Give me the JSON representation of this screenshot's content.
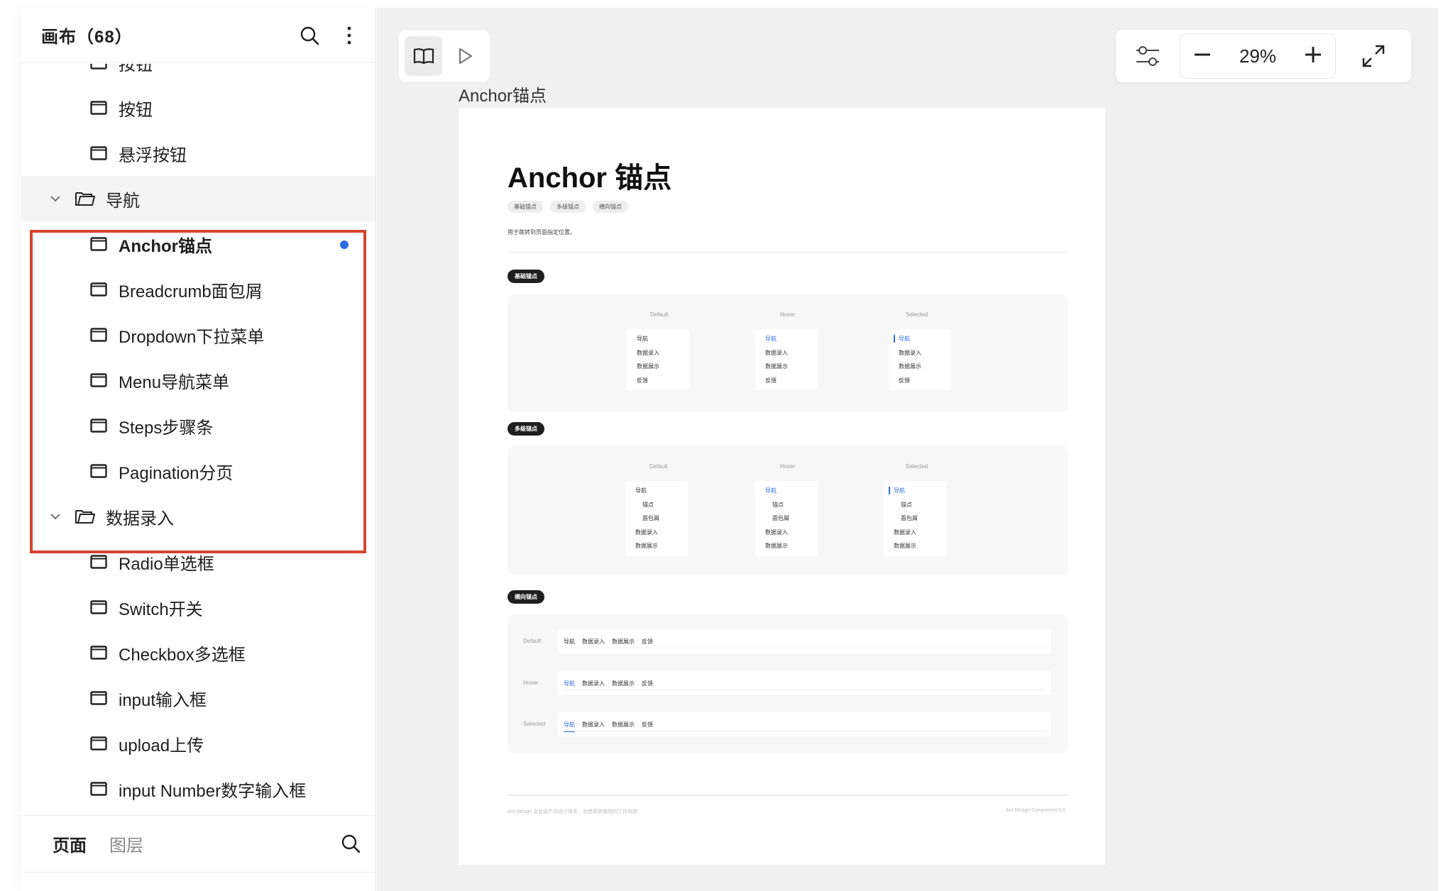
{
  "sidebar": {
    "title": "画布（68）",
    "partial_item": "按钮",
    "items": [
      {
        "type": "page",
        "label": "按钮"
      },
      {
        "type": "page",
        "label": "悬浮按钮"
      },
      {
        "type": "folder",
        "label": "导航"
      },
      {
        "type": "page",
        "label": "Anchor锚点"
      },
      {
        "type": "page",
        "label": "Breadcrumb面包屑"
      },
      {
        "type": "page",
        "label": "Dropdown下拉菜单"
      },
      {
        "type": "page",
        "label": "Menu导航菜单"
      },
      {
        "type": "page",
        "label": "Steps步骤条"
      },
      {
        "type": "page",
        "label": "Pagination分页"
      },
      {
        "type": "folder",
        "label": "数据录入"
      },
      {
        "type": "page",
        "label": "Radio单选框"
      },
      {
        "type": "page",
        "label": "Switch开关"
      },
      {
        "type": "page",
        "label": "Checkbox多选框"
      },
      {
        "type": "page",
        "label": "input输入框"
      },
      {
        "type": "page",
        "label": "upload上传"
      },
      {
        "type": "page",
        "label": "input Number数字输入框"
      }
    ],
    "footer": {
      "pages_tab": "页面",
      "layers_tab": "图层"
    }
  },
  "canvas": {
    "frame_label": "Anchor锚点",
    "zoom": "29%",
    "icons": {
      "read_mode": "book-icon",
      "play": "play-icon",
      "settings": "sliders-icon",
      "zoom_out": "minus-icon",
      "zoom_in": "plus-icon",
      "fullscreen": "expand-icon"
    }
  },
  "artboard": {
    "title": "Anchor 锚点",
    "tags": [
      "基础锚点",
      "多级锚点",
      "横向锚点"
    ],
    "description": "用于跳转到页面指定位置。",
    "section1": {
      "pill": "基础锚点",
      "columns": [
        {
          "head": "Default",
          "items": [
            "导航",
            "数据录入",
            "数据展示",
            "反馈"
          ]
        },
        {
          "head": "Hover",
          "items": [
            "导航",
            "数据录入",
            "数据展示",
            "反馈"
          ]
        },
        {
          "head": "Selected",
          "items": [
            "导航",
            "数据录入",
            "数据展示",
            "反馈"
          ]
        }
      ]
    },
    "section2": {
      "pill": "多级锚点",
      "columns": [
        {
          "head": "Default",
          "items": [
            "导航",
            "锚点",
            "面包屑",
            "数据录入",
            "数据展示"
          ]
        },
        {
          "head": "Hover",
          "items": [
            "导航",
            "锚点",
            "面包屑",
            "数据录入",
            "数据展示"
          ]
        },
        {
          "head": "Selected",
          "items": [
            "导航",
            "锚点",
            "面包屑",
            "数据录入",
            "数据展示"
          ]
        }
      ]
    },
    "section3": {
      "pill": "横向锚点",
      "rows": [
        {
          "label": "Default",
          "items": [
            "导航",
            "数据录入",
            "数据展示",
            "反馈"
          ]
        },
        {
          "label": "Hover",
          "items": [
            "导航",
            "数据录入",
            "数据展示",
            "反馈"
          ]
        },
        {
          "label": "Selected",
          "items": [
            "导航",
            "数据录入",
            "数据展示",
            "反馈"
          ]
        }
      ]
    },
    "footer_left": "Ant Design 企业级产品设计体系，创造高效愉悦的工作体验",
    "footer_right": "Ant Design Component 5.0"
  },
  "colors": {
    "accent": "#2f6be0",
    "highlight": "#d6442f",
    "canvas_bg": "#f0f0f0"
  }
}
